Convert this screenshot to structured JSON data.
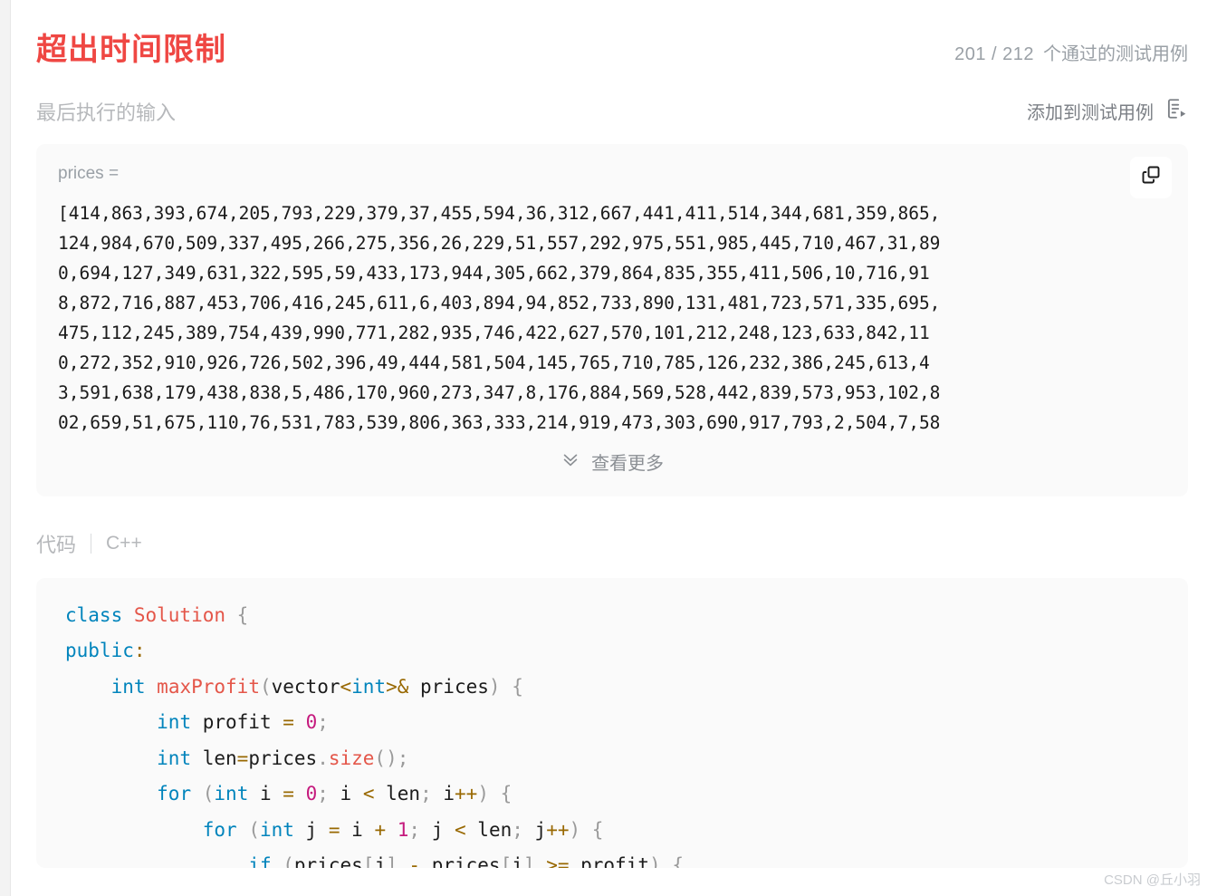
{
  "header": {
    "verdict": "超出时间限制",
    "verdict_color": "#ef4743",
    "testcases_passed": "201 / 212",
    "testcases_suffix": "个通过的测试用例"
  },
  "input_section": {
    "label": "最后执行的输入",
    "add_testcase_label": "添加到测试用例",
    "add_testcase_icon": "doc-play-icon",
    "variable_name": "prices =",
    "copy_icon": "copy-icon",
    "array_lines": [
      "[414,863,393,674,205,793,229,379,37,455,594,36,312,667,441,411,514,344,681,359,865,",
      "124,984,670,509,337,495,266,275,356,26,229,51,557,292,975,551,985,445,710,467,31,89",
      "0,694,127,349,631,322,595,59,433,173,944,305,662,379,864,835,355,411,506,10,716,91",
      "8,872,716,887,453,706,416,245,611,6,403,894,94,852,733,890,131,481,723,571,335,695,",
      "475,112,245,389,754,439,990,771,282,935,746,422,627,570,101,212,248,123,633,842,11",
      "0,272,352,910,926,726,502,396,49,444,581,504,145,765,710,785,126,232,386,245,613,4",
      "3,591,638,179,438,838,5,486,170,960,273,347,8,176,884,569,528,442,839,573,953,102,8",
      "02,659,51,675,110,76,531,783,539,806,363,333,214,919,473,303,690,917,793,2,504,7,58"
    ],
    "view_more_label": "查看更多",
    "view_more_icon": "chevron-double-down-icon"
  },
  "code_section": {
    "label": "代码",
    "language": "C++",
    "lines": [
      [
        {
          "t": "class ",
          "c": "kw"
        },
        {
          "t": "Solution",
          "c": "ty"
        },
        {
          "t": " {",
          "c": "pun"
        }
      ],
      [
        {
          "t": "public",
          "c": "kw"
        },
        {
          "t": ":",
          "c": "op"
        }
      ],
      [
        {
          "t": "    ",
          "c": "pln"
        },
        {
          "t": "int",
          "c": "kw"
        },
        {
          "t": " ",
          "c": "pln"
        },
        {
          "t": "maxProfit",
          "c": "fn"
        },
        {
          "t": "(",
          "c": "pun"
        },
        {
          "t": "vector",
          "c": "pln"
        },
        {
          "t": "<",
          "c": "op"
        },
        {
          "t": "int",
          "c": "kw"
        },
        {
          "t": ">&",
          "c": "op"
        },
        {
          "t": " prices",
          "c": "pln"
        },
        {
          "t": ")",
          "c": "pun"
        },
        {
          "t": " ",
          "c": "pln"
        },
        {
          "t": "{",
          "c": "pun"
        }
      ],
      [
        {
          "t": "        ",
          "c": "pln"
        },
        {
          "t": "int",
          "c": "kw"
        },
        {
          "t": " profit ",
          "c": "pln"
        },
        {
          "t": "=",
          "c": "op"
        },
        {
          "t": " ",
          "c": "pln"
        },
        {
          "t": "0",
          "c": "num"
        },
        {
          "t": ";",
          "c": "pun"
        }
      ],
      [
        {
          "t": "        ",
          "c": "pln"
        },
        {
          "t": "int",
          "c": "kw"
        },
        {
          "t": " len",
          "c": "pln"
        },
        {
          "t": "=",
          "c": "op"
        },
        {
          "t": "prices",
          "c": "pln"
        },
        {
          "t": ".",
          "c": "pun"
        },
        {
          "t": "size",
          "c": "fn"
        },
        {
          "t": "()",
          "c": "pun"
        },
        {
          "t": ";",
          "c": "pun"
        }
      ],
      [
        {
          "t": "        ",
          "c": "pln"
        },
        {
          "t": "for",
          "c": "kw"
        },
        {
          "t": " ",
          "c": "pln"
        },
        {
          "t": "(",
          "c": "pun"
        },
        {
          "t": "int",
          "c": "kw"
        },
        {
          "t": " i ",
          "c": "pln"
        },
        {
          "t": "=",
          "c": "op"
        },
        {
          "t": " ",
          "c": "pln"
        },
        {
          "t": "0",
          "c": "num"
        },
        {
          "t": ";",
          "c": "pun"
        },
        {
          "t": " i ",
          "c": "pln"
        },
        {
          "t": "<",
          "c": "op"
        },
        {
          "t": " len",
          "c": "pln"
        },
        {
          "t": ";",
          "c": "pun"
        },
        {
          "t": " i",
          "c": "pln"
        },
        {
          "t": "++",
          "c": "op"
        },
        {
          "t": ")",
          "c": "pun"
        },
        {
          "t": " ",
          "c": "pln"
        },
        {
          "t": "{",
          "c": "pun"
        }
      ],
      [
        {
          "t": "            ",
          "c": "pln"
        },
        {
          "t": "for",
          "c": "kw"
        },
        {
          "t": " ",
          "c": "pln"
        },
        {
          "t": "(",
          "c": "pun"
        },
        {
          "t": "int",
          "c": "kw"
        },
        {
          "t": " j ",
          "c": "pln"
        },
        {
          "t": "=",
          "c": "op"
        },
        {
          "t": " i ",
          "c": "pln"
        },
        {
          "t": "+",
          "c": "op"
        },
        {
          "t": " ",
          "c": "pln"
        },
        {
          "t": "1",
          "c": "num"
        },
        {
          "t": ";",
          "c": "pun"
        },
        {
          "t": " j ",
          "c": "pln"
        },
        {
          "t": "<",
          "c": "op"
        },
        {
          "t": " len",
          "c": "pln"
        },
        {
          "t": ";",
          "c": "pun"
        },
        {
          "t": " j",
          "c": "pln"
        },
        {
          "t": "++",
          "c": "op"
        },
        {
          "t": ")",
          "c": "pun"
        },
        {
          "t": " ",
          "c": "pln"
        },
        {
          "t": "{",
          "c": "pun"
        }
      ],
      [
        {
          "t": "                ",
          "c": "pln"
        },
        {
          "t": "if",
          "c": "kw"
        },
        {
          "t": " ",
          "c": "pln"
        },
        {
          "t": "(",
          "c": "pun"
        },
        {
          "t": "prices",
          "c": "pln"
        },
        {
          "t": "[",
          "c": "pun"
        },
        {
          "t": "j",
          "c": "pln"
        },
        {
          "t": "]",
          "c": "pun"
        },
        {
          "t": " ",
          "c": "pln"
        },
        {
          "t": "-",
          "c": "op"
        },
        {
          "t": " prices",
          "c": "pln"
        },
        {
          "t": "[",
          "c": "pun"
        },
        {
          "t": "i",
          "c": "pln"
        },
        {
          "t": "]",
          "c": "pun"
        },
        {
          "t": " ",
          "c": "pln"
        },
        {
          "t": ">=",
          "c": "op"
        },
        {
          "t": " profit",
          "c": "pln"
        },
        {
          "t": ")",
          "c": "pun"
        },
        {
          "t": " ",
          "c": "pln"
        },
        {
          "t": "{",
          "c": "pun"
        }
      ]
    ]
  },
  "watermark": "CSDN @丘小羽"
}
